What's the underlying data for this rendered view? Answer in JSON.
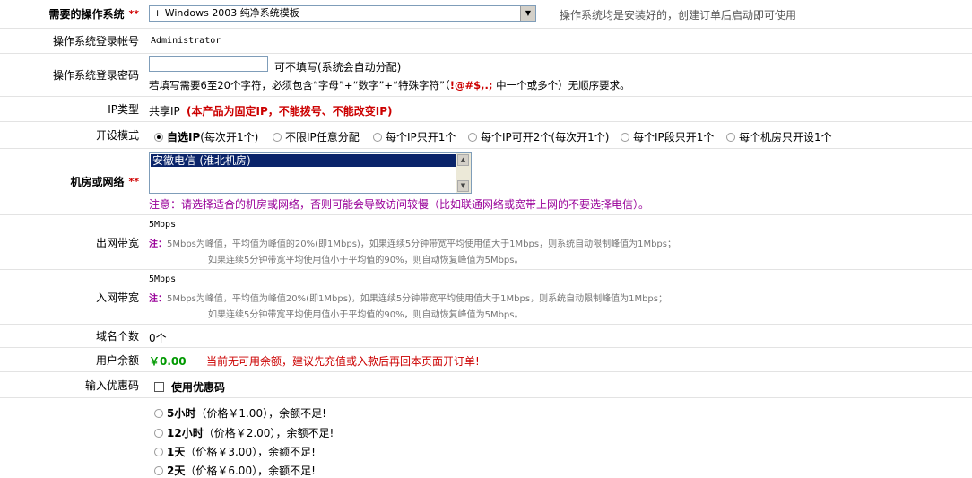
{
  "os": {
    "label": "需要的操作系统",
    "required": "**",
    "selected": "+ Windows 2003 纯净系统模板",
    "hint": "操作系统均是安装好的，创建订单后启动即可使用"
  },
  "login_account": {
    "label": "操作系统登录帐号",
    "value": "Administrator"
  },
  "login_password": {
    "label": "操作系统登录密码",
    "value": "",
    "optional_note": "可不填写(系统会自动分配)",
    "rule_prefix": "若填写需要6至20个字符，必须包含“字母”+“数字”+“特殊字符”（",
    "rule_chars": "!@#$,.;",
    "rule_suffix": " 中一个或多个）无顺序要求。"
  },
  "ip_type": {
    "label": "IP类型",
    "value": "共享IP",
    "note": "(本产品为固定IP，不能拨号、不能改变IP)"
  },
  "open_mode": {
    "label": "开设模式",
    "options": [
      {
        "label": "自选IP",
        "sub": "(每次开1个)",
        "checked": true
      },
      {
        "label": "不限IP任意分配",
        "sub": "",
        "checked": false
      },
      {
        "label": "每个IP只开1个",
        "sub": "",
        "checked": false
      },
      {
        "label": "每个IP可开2个(每次开1个)",
        "sub": "",
        "checked": false
      },
      {
        "label": "每个IP段只开1个",
        "sub": "",
        "checked": false
      },
      {
        "label": "每个机房只开设1个",
        "sub": "",
        "checked": false
      }
    ]
  },
  "datacenter": {
    "label": "机房或网络",
    "required": "**",
    "selected": "安徽电信-(淮北机房)",
    "note": "注意：请选择适合的机房或网络，否则可能会导致访问较慢（比如联通网络或宽带上网的不要选择电信）。"
  },
  "out_bandwidth": {
    "label": "出网带宽",
    "value": "5Mbps",
    "note_key": "注：",
    "note_line1": "5Mbps为峰值，平均值为峰值的20%(即1Mbps)，如果连续5分钟带宽平均使用值大于1Mbps，则系统自动限制峰值为1Mbps；",
    "note_line2": "如果连续5分钟带宽平均使用值小于平均值的90%，则自动恢复峰值为5Mbps。"
  },
  "in_bandwidth": {
    "label": "入网带宽",
    "value": "5Mbps",
    "note_key": "注：",
    "note_line1": "5Mbps为峰值，平均值为峰值20%(即1Mbps)，如果连续5分钟带宽平均使用值大于1Mbps，则系统自动限制峰值为1Mbps；",
    "note_line2": "如果连续5分钟带宽平均使用值小于平均值的90%，则自动恢复峰值为5Mbps。"
  },
  "domains": {
    "label": "域名个数",
    "value": "0个"
  },
  "balance": {
    "label": "用户余额",
    "value": "￥0.00",
    "warning": "当前无可用余额，建议先充值或入款后再回本页面开订单!"
  },
  "coupon": {
    "label": "输入优惠码",
    "checkbox_label": "使用优惠码",
    "checked": false
  },
  "durations": [
    {
      "label": "5小时",
      "price": "（价格￥1.00）",
      "status": "，余额不足!"
    },
    {
      "label": "12小时",
      "price": "（价格￥2.00）",
      "status": "，余额不足!"
    },
    {
      "label": "1天",
      "price": "（价格￥3.00）",
      "status": "，余额不足!"
    },
    {
      "label": "2天",
      "price": "（价格￥6.00）",
      "status": "，余额不足!"
    }
  ]
}
